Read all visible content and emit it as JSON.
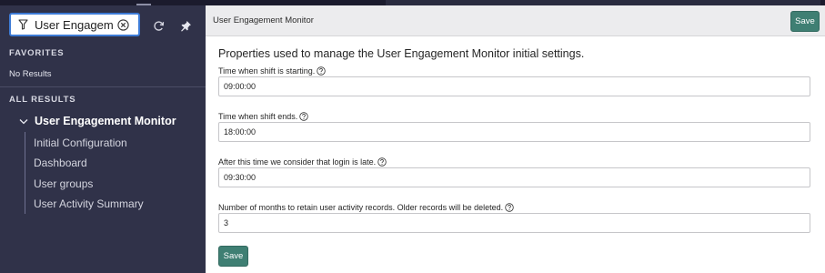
{
  "sidebar": {
    "filter_value": "User Engagemen",
    "favorites_label": "FAVORITES",
    "no_results": "No Results",
    "all_results_label": "ALL RESULTS",
    "app_title": "User Engagement Monitor",
    "items": [
      {
        "label": "Initial Configuration"
      },
      {
        "label": "Dashboard"
      },
      {
        "label": "User groups"
      },
      {
        "label": "User Activity Summary"
      }
    ]
  },
  "header": {
    "title": "User Engagement Monitor",
    "save_label": "Save"
  },
  "form": {
    "intro": "Properties used to manage the User Engagement Monitor initial settings.",
    "fields": [
      {
        "label": "Time when shift is starting.",
        "value": "09:00:00"
      },
      {
        "label": "Time when shift ends.",
        "value": "18:00:00"
      },
      {
        "label": "After this time we consider that login is late.",
        "value": "09:30:00"
      },
      {
        "label": "Number of months to retain user activity records. Older records will be deleted.",
        "value": "3"
      }
    ],
    "save_label": "Save"
  },
  "colors": {
    "sidebar_bg": "#303249",
    "accent_green": "#3f7f73",
    "filter_focus": "#3d7bd6"
  },
  "icons": [
    "filter-icon",
    "clear-icon",
    "refresh-icon",
    "pin-icon",
    "chevron-down-icon",
    "help-icon"
  ]
}
